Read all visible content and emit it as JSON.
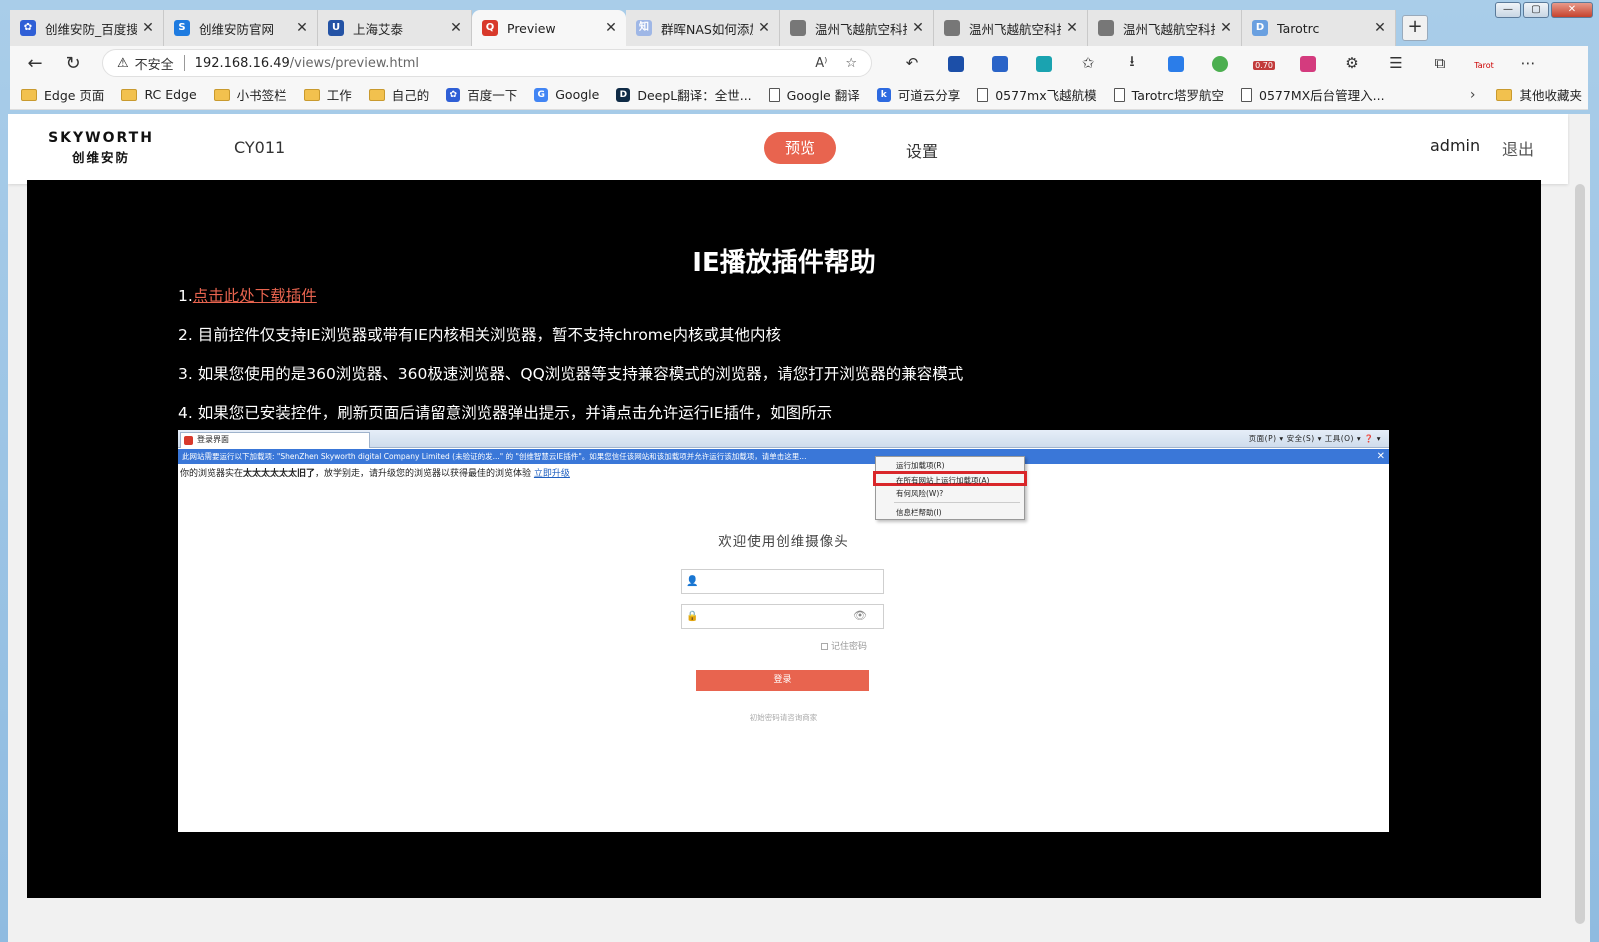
{
  "window": {
    "controls": {
      "minimize": "—",
      "maximize": "▢",
      "close": "✕"
    }
  },
  "tabs": [
    {
      "title": "创维安防_百度搜",
      "icon": "baidu-icon",
      "color": "#2f5fd6",
      "active": false
    },
    {
      "title": "创维安防官网",
      "icon": "s-icon",
      "color": "#1e7be0",
      "active": false
    },
    {
      "title": "上海艾泰",
      "icon": "utt-icon",
      "color": "#2453a5",
      "active": false
    },
    {
      "title": "Preview",
      "icon": "preview-icon",
      "color": "#d8392b",
      "active": true
    },
    {
      "title": "群晖NAS如何添加",
      "icon": "zhihu-icon",
      "color": "#9fb7e6",
      "active": false
    },
    {
      "title": "温州飞越航空科技",
      "icon": "page-icon",
      "color": "#777777",
      "active": false
    },
    {
      "title": "温州飞越航空科技",
      "icon": "page-icon",
      "color": "#777777",
      "active": false
    },
    {
      "title": "温州飞越航空科技",
      "icon": "page-icon",
      "color": "#777777",
      "active": false
    },
    {
      "title": "Tarotrc",
      "icon": "dsm-icon",
      "color": "#6aa0e0",
      "active": false
    }
  ],
  "tab_icon_text": [
    "✿",
    "S",
    "U",
    "Q",
    "知",
    "",
    "",
    "",
    "D"
  ],
  "address": {
    "security_label": "不安全",
    "host": "192.168.16.49",
    "path": "/views/preview.html"
  },
  "bookmarks": [
    {
      "label": "Edge 页面",
      "type": "folder"
    },
    {
      "label": "RC Edge",
      "type": "folder"
    },
    {
      "label": "小书签栏",
      "type": "folder"
    },
    {
      "label": "工作",
      "type": "folder"
    },
    {
      "label": "自己的",
      "type": "folder"
    },
    {
      "label": "百度一下",
      "type": "icon",
      "color": "#2f5fd6",
      "glyph": "✿"
    },
    {
      "label": "Google",
      "type": "icon",
      "color": "#4285f4",
      "glyph": "G"
    },
    {
      "label": "DeepL翻译：全世...",
      "type": "icon",
      "color": "#0f2b46",
      "glyph": "D"
    },
    {
      "label": "Google 翻译",
      "type": "page"
    },
    {
      "label": "可道云分享",
      "type": "icon",
      "color": "#2d6ae0",
      "glyph": "k"
    },
    {
      "label": "0577mx飞越航模",
      "type": "page"
    },
    {
      "label": "Tarotrc塔罗航空",
      "type": "page"
    },
    {
      "label": "0577MX后台管理入...",
      "type": "page"
    }
  ],
  "bookmarks_other": "其他收藏夹",
  "extension_badge": "0.70",
  "app": {
    "brand_en": "SKYWORTH",
    "brand_cn": "创维安防",
    "device": "CY011",
    "nav_preview": "预览",
    "nav_settings": "设置",
    "user": "admin",
    "logout": "退出"
  },
  "help": {
    "title": "IE播放插件帮助",
    "line1_prefix": "1.",
    "line1_link": "点击此处下载插件",
    "line2": "2. 目前控件仅支持IE浏览器或带有IE内核相关浏览器，暂不支持chrome内核或其他内核",
    "line3": "3. 如果您使用的是360浏览器、360极速浏览器、QQ浏览器等支持兼容模式的浏览器，请您打开浏览器的兼容模式",
    "line4": "4. 如果您已安装控件，刷新页面后请留意浏览器弹出提示，并请点击允许运行IE插件，如图所示"
  },
  "screenshot": {
    "ie_tab": "登录界面",
    "ie_tools": "页面(P) ▾   安全(S) ▾   工具(O) ▾   ❓ ▾",
    "infobar": "此网站需要运行以下加载项: \"ShenZhen Skyworth digital Company Limited (未验证的发...\" 的 \"创维智慧云IE插件\"。如果您信任该网站和该加载项并允许运行该加载项，请单击这里...",
    "notice_prefix": "你的浏览器实在",
    "notice_bold": "太太太太太太旧了",
    "notice_mid": "，放学别走，请升级您的浏览器以获得最佳的浏览体验",
    "notice_link": "立即升级",
    "menu": [
      "运行加载项(R)",
      "在所有网站上运行加载项(A)",
      "有何风险(W)?",
      "信息栏帮助(I)"
    ],
    "login_title": "欢迎使用创维摄像头",
    "remember": "记住密码",
    "login_button": "登录",
    "login_hint": "初始密码请咨询商家"
  }
}
